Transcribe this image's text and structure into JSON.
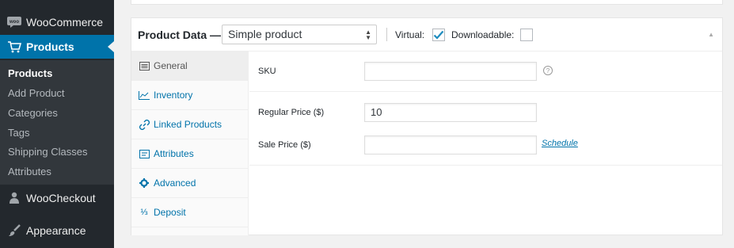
{
  "sidebar": {
    "woocommerce_label": "WooCommerce",
    "products_label": "Products",
    "submenu": [
      "Products",
      "Add Product",
      "Categories",
      "Tags",
      "Shipping Classes",
      "Attributes"
    ],
    "woocheckout_label": "WooCheckout",
    "appearance_label": "Appearance",
    "woo_badge": "woo"
  },
  "panel": {
    "title": "Product Data —",
    "product_type": "Simple product",
    "virtual_label": "Virtual:",
    "virtual_checked": true,
    "downloadable_label": "Downloadable:",
    "downloadable_checked": false
  },
  "tabs": [
    {
      "label": "General",
      "icon": "general-icon"
    },
    {
      "label": "Inventory",
      "icon": "inventory-icon"
    },
    {
      "label": "Linked Products",
      "icon": "link-icon"
    },
    {
      "label": "Attributes",
      "icon": "attributes-icon"
    },
    {
      "label": "Advanced",
      "icon": "gear-icon"
    },
    {
      "label": "Deposit",
      "icon": "deposit-icon"
    }
  ],
  "deposit_glyph": "⅓",
  "fields": {
    "sku_label": "SKU",
    "sku_value": "",
    "help_glyph": "?",
    "regular_price_label": "Regular Price ($)",
    "regular_price_value": "10",
    "sale_price_label": "Sale Price ($)",
    "sale_price_value": "",
    "schedule_link": "Schedule"
  },
  "colors": {
    "sidebar_bg": "#23282d",
    "accent": "#0073aa"
  }
}
